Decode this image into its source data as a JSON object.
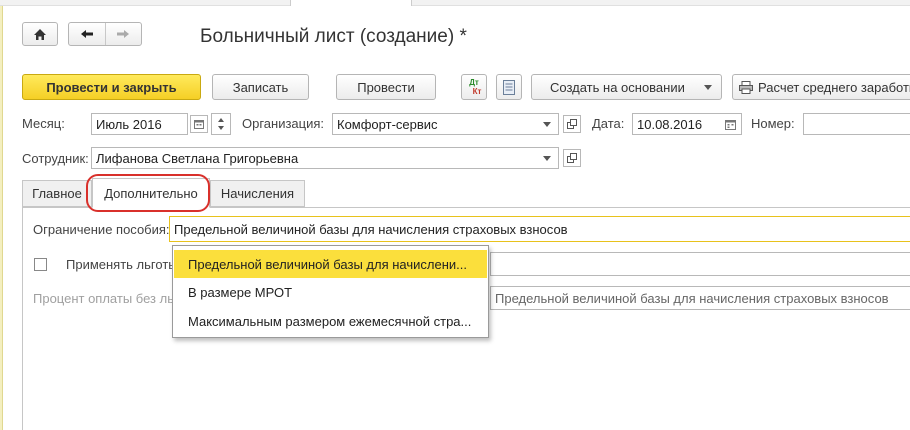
{
  "window": {
    "title": "Больничный лист (создание) *"
  },
  "nav": {
    "home_icon": "home-icon",
    "back_icon": "arrow-left-icon",
    "forward_icon": "arrow-right-icon"
  },
  "toolbar": {
    "post_close": "Провести и закрыть",
    "save": "Записать",
    "post": "Провести",
    "dtkt_top": "Дт",
    "dtkt_bottom": "Кт",
    "create_based": "Создать на основании",
    "avg_calc": "Расчет среднего заработка"
  },
  "form": {
    "month_label": "Месяц:",
    "month_value": "Июль 2016",
    "org_label": "Организация:",
    "org_value": "Комфорт-сервис",
    "date_label": "Дата:",
    "date_value": "10.08.2016",
    "number_label": "Номер:",
    "number_value": "",
    "employee_label": "Сотрудник:",
    "employee_value": "Лифанова Светлана Григорьевна"
  },
  "tabs": [
    {
      "label": "Главное"
    },
    {
      "label": "Дополнительно"
    },
    {
      "label": "Начисления"
    }
  ],
  "tab_content": {
    "limit_label": "Ограничение пособия:",
    "limit_value": "Предельной величиной базы для начисления страховых взносов",
    "apply_label": "Применять льготы",
    "percent_label": "Процент оплаты без льгот",
    "percent_limit_value": "Предельной величиной базы для начисления страховых взносов"
  },
  "dropdown": {
    "items": [
      {
        "label": "Предельной величиной базы для начислени..."
      },
      {
        "label": "В размере МРОТ"
      },
      {
        "label": "Максимальным размером ежемесячной стра..."
      }
    ],
    "selected_index": 0
  },
  "colors": {
    "accent_yellow": "#fbdf3c",
    "highlight_red": "#d9302b"
  }
}
